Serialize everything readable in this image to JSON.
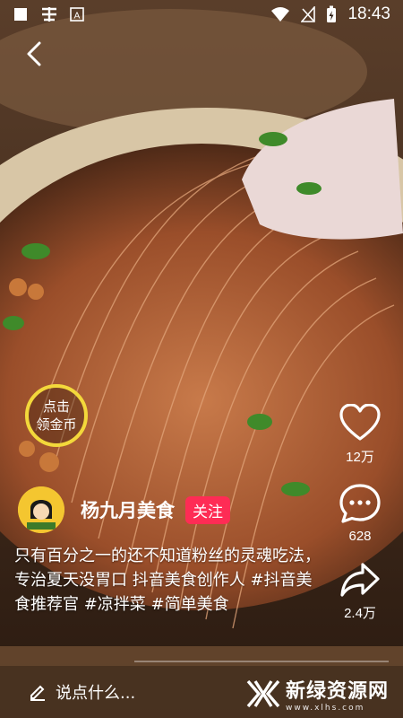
{
  "status_bar": {
    "time": "18:43",
    "left_icons": [
      "notification-icon",
      "app-icon",
      "a-icon"
    ],
    "right_icons": [
      "wifi-icon",
      "signal-icon",
      "battery-icon"
    ]
  },
  "coin_button": {
    "line1": "点击",
    "line2": "领金币"
  },
  "actions": {
    "like_count": "12万",
    "comment_count": "628",
    "share_count": "2.4万"
  },
  "author": {
    "name": "杨九月美食",
    "follow_label": "关注"
  },
  "caption": "只有百分之一的还不知道粉丝的灵魂吃法，专治夏天没胃口 抖音美食创作人 #抖音美食推荐官 #凉拌菜 #简单美食",
  "progress": 0.0,
  "comment_input": {
    "placeholder": "说点什么..."
  },
  "watermark": {
    "title": "新绿资源网",
    "subtitle": "www.xlhs.com"
  },
  "colors": {
    "follow": "#fe2c55",
    "coin_ring": "#f3d83b"
  }
}
